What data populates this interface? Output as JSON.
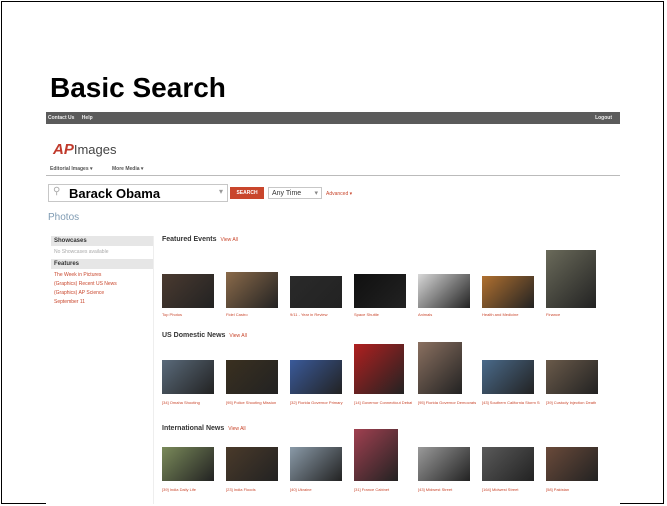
{
  "slide": {
    "title": "Basic Search"
  },
  "site": {
    "topbar": {
      "contact": "Contact Us",
      "help": "Help",
      "logout": "Logout"
    },
    "logo": {
      "ap": "AP",
      "images": "Images"
    },
    "tabs": [
      "Editorial Images ▾",
      "More Media ▾"
    ],
    "search": {
      "value": "Barack Obama",
      "button": "SEARCH",
      "time": "Any Time",
      "advanced": "Advanced ▾"
    },
    "photos_label": "Photos",
    "sidebar": {
      "showcases_title": "Showcases",
      "showcases_note": "No Showcases available",
      "features_title": "Features",
      "feature_links": [
        "The Week in Pictures",
        "(Graphics) Recent US News",
        "(Graphics) AP Science",
        "September 11"
      ]
    },
    "sections": [
      {
        "title": "Featured Events",
        "view_all": "View All",
        "items": [
          {
            "caption": "Top Photos",
            "color": "#4a3a30"
          },
          {
            "caption": "Fidel Castro",
            "color": "#8a6a4a"
          },
          {
            "caption": "9/11 - Year in Review",
            "color": "#2a2a2a"
          },
          {
            "caption": "Space Shuttle",
            "color": "#101010"
          },
          {
            "caption": "Animals",
            "color": "#d8d8d8"
          },
          {
            "caption": "Health and Medicine",
            "color": "#b07030"
          },
          {
            "caption": "Finance",
            "color": "#6a6a5a"
          }
        ]
      },
      {
        "title": "US Domestic News",
        "view_all": "View All",
        "items": [
          {
            "caption": "[34] Omaha Shooting",
            "color": "#5a6a7a"
          },
          {
            "caption": "[95] Police Shooting Mission",
            "color": "#3a3020"
          },
          {
            "caption": "[32] Florida Governor Primary",
            "color": "#3a5a9a"
          },
          {
            "caption": "[14] Governor Connecticut Debate",
            "color": "#b02020"
          },
          {
            "caption": "[95] Florida Governor Democrats",
            "color": "#8a7060"
          },
          {
            "caption": "[43] Southern California Storm Surf",
            "color": "#4a6a8a"
          },
          {
            "caption": "[39] Custody Injection Death",
            "color": "#6a5a4a"
          }
        ]
      },
      {
        "title": "International News",
        "view_all": "View All",
        "items": [
          {
            "caption": "[39] India Daily Life",
            "color": "#7a8a5a"
          },
          {
            "caption": "[23] India Floods",
            "color": "#4a3a2a"
          },
          {
            "caption": "[40] Ukraine",
            "color": "#8a9aa8"
          },
          {
            "caption": "[31] France Cabinet",
            "color": "#a04050"
          },
          {
            "caption": "[43] Midwest Street",
            "color": "#9a9a9a"
          },
          {
            "caption": "[164] Midwest Street",
            "color": "#5a5a5a"
          },
          {
            "caption": "[58] Pakistan",
            "color": "#6a4a3a"
          }
        ]
      }
    ]
  }
}
